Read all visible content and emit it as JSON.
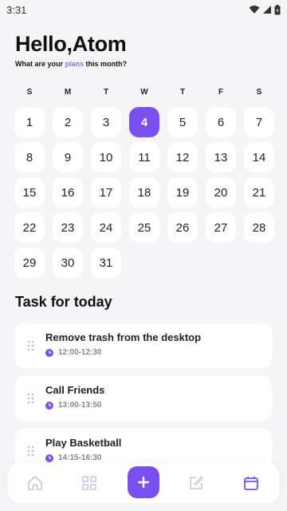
{
  "status_bar": {
    "time": "3:31"
  },
  "header": {
    "greeting": "Hello,Atom",
    "subtitle_before": "What are your ",
    "subtitle_accent": "plans",
    "subtitle_after": " this month?"
  },
  "calendar": {
    "weekdays": [
      "S",
      "M",
      "T",
      "W",
      "T",
      "F",
      "S"
    ],
    "days": [
      "1",
      "2",
      "3",
      "4",
      "5",
      "6",
      "7",
      "8",
      "9",
      "10",
      "11",
      "12",
      "13",
      "14",
      "15",
      "16",
      "17",
      "18",
      "19",
      "20",
      "21",
      "22",
      "23",
      "24",
      "25",
      "26",
      "27",
      "28",
      "29",
      "30",
      "31"
    ],
    "selected_day": "4"
  },
  "tasks_section": {
    "title": "Task for today",
    "tasks": [
      {
        "title": "Remove trash from the desktop",
        "time": "12:00-12:30"
      },
      {
        "title": "Call Friends",
        "time": "13:00-13:50"
      },
      {
        "title": "Play Basketball",
        "time": "14:15-16:30"
      }
    ]
  },
  "bottom_nav": {
    "items": [
      "home-icon",
      "grid-icon",
      "add-icon",
      "edit-icon",
      "calendar-icon"
    ]
  },
  "colors": {
    "accent": "#7a4ff0",
    "accent_light": "#8b6cf2",
    "background": "#f5f5f7",
    "card": "#ffffff",
    "nav_icon": "#c7c0e6"
  }
}
